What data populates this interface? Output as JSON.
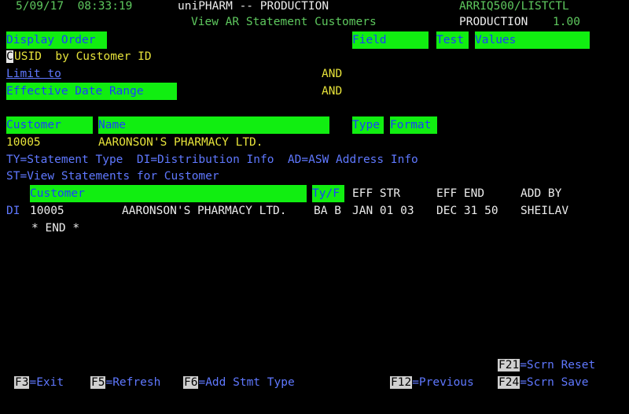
{
  "header": {
    "datetime": "5/09/17  08:33:19",
    "system": "uniPHARM -- PRODUCTION",
    "program": "ARRIQ500/LISTCTL",
    "screen_title": "View AR Statement Customers",
    "env": "PRODUCTION",
    "version": "1.00"
  },
  "criteria": {
    "display_order_label": "Display Order",
    "field_label": "Field",
    "test_label": "Test",
    "values_label": "Values",
    "order_cursor": "C",
    "order_value": "USID  by Customer ID",
    "limit_to_label": "Limit to",
    "and1": "AND",
    "effective_date_label": "Effective Date Range",
    "and2": "AND"
  },
  "customer_header": {
    "customer": "Customer",
    "name": "Name",
    "type": "Type",
    "format": "Format"
  },
  "customer": {
    "id": "10005",
    "name": "AARONSON'S PHARMACY LTD."
  },
  "options": {
    "line1": "TY=Statement Type  DI=Distribution Info  AD=ASW Address Info",
    "line2": "ST=View Statements for Customer"
  },
  "list": {
    "headers": {
      "customer": "Customer",
      "ty_f": "Ty/F",
      "eff_str": "EFF STR",
      "eff_end": "EFF END",
      "add_by": "ADD BY"
    },
    "rows": [
      {
        "opt": "DI",
        "id": "10005",
        "name": "AARONSON'S PHARMACY LTD.",
        "ty_f": "BA B",
        "eff_str": "JAN 01 03",
        "eff_end": "DEC 31 50",
        "add_by": "SHEILAV"
      }
    ],
    "end_marker": "* END *"
  },
  "fkeys": {
    "f21": {
      "key": "F21",
      "label": "=Scrn Reset"
    },
    "f3": {
      "key": "F3",
      "label": "=Exit"
    },
    "f5": {
      "key": "F5",
      "label": "=Refresh"
    },
    "f6": {
      "key": "F6",
      "label": "=Add Stmt Type"
    },
    "f12": {
      "key": "F12",
      "label": "=Previous"
    },
    "f24": {
      "key": "F24",
      "label": "=Scrn Save"
    }
  },
  "colors": {
    "background": "#000000",
    "field_highlight": "#11ee11",
    "field_text": "#1a3dff",
    "green_text": "#5ec85e",
    "yellow_text": "#e6e23a",
    "blue_text": "#5f78ff"
  }
}
